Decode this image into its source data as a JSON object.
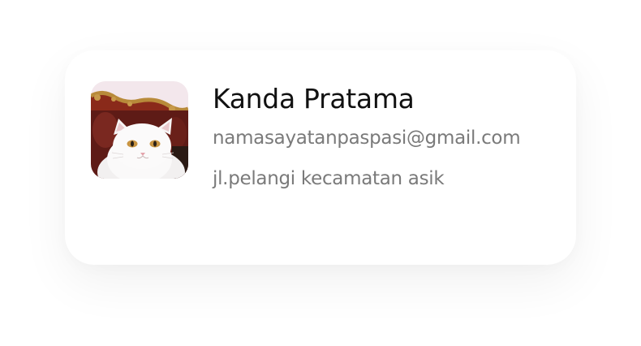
{
  "profile": {
    "name": "Kanda Pratama",
    "email": "namasayatanpaspasi@gmail.com",
    "address": "jl.pelangi kecamatan asik",
    "avatar": "white-cat-photo"
  },
  "colors": {
    "name": "#111111",
    "secondary_text": "#7a7a7a",
    "card_background": "#ffffff"
  }
}
